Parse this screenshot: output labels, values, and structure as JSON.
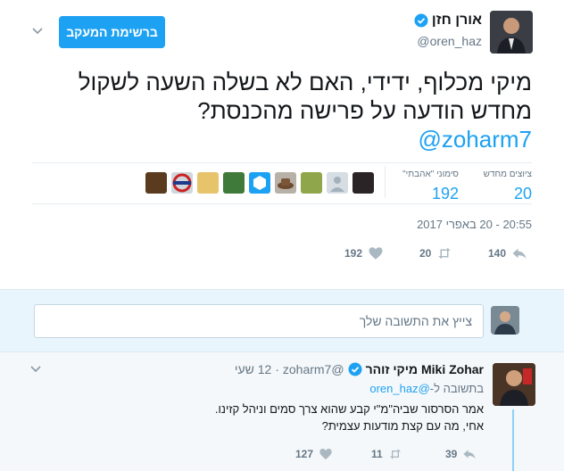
{
  "tweet": {
    "follow_button": "ברשימת המעקב",
    "author_name": "אורן חזן",
    "author_handle": "@oren_haz",
    "text": "מיקי מכלוף, ידידי, האם לא בשלה השעה לשקול מחדש הודעה על פרישה מהכנסת?",
    "mention": "@zoharm7",
    "stats": {
      "retweets_label": "ציוצים מחדש",
      "retweets_value": "20",
      "likes_label": "סימוני \"אהבתי\"",
      "likes_value": "192"
    },
    "timestamp": "20:55 - 20 באפרי 2017",
    "actions": {
      "reply_count": "140",
      "retweet_count": "20",
      "like_count": "192"
    }
  },
  "reply_box": {
    "placeholder": "צייץ את התשובה שלך"
  },
  "reply_tweet": {
    "name": "Miki Zohar מיקי זוהר",
    "handle": "@zoharm7",
    "time": "· 12 שעי",
    "in_reply_prefix": "בתשובה ל-",
    "in_reply_handle": "@oren_haz",
    "line1": "אמר הסרסור שביה\"מ\"י קבע שהוא צרך סמים וניהל קזינו.",
    "line2": "אחי, מה עם קצת מודעות עצמית?",
    "reply_count": "39",
    "retweet_count": "11",
    "like_count": "127"
  },
  "colors": {
    "accent": "#1da1f2",
    "muted": "#657786",
    "reply_bg": "#e8f5fd"
  }
}
